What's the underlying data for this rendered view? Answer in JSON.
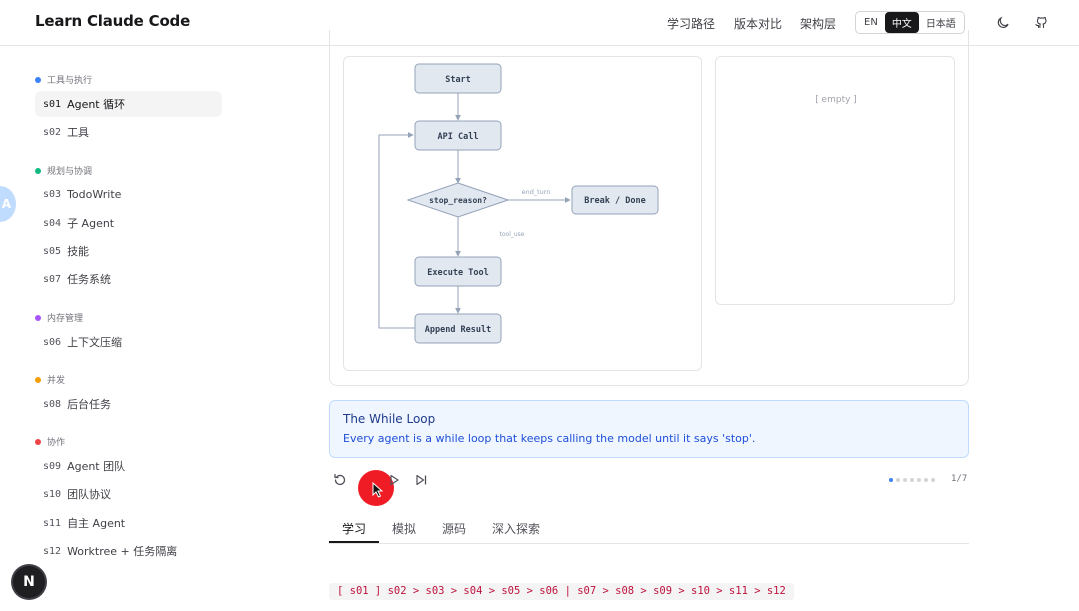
{
  "header": {
    "brand": "Learn Claude Code",
    "nav": [
      "学习路径",
      "版本对比",
      "架构层"
    ],
    "languages": [
      "EN",
      "中文",
      "日本語"
    ],
    "active_language": "中文",
    "icons": [
      "moon-icon",
      "github-icon"
    ]
  },
  "sidebar": {
    "groups": [
      {
        "title": "工具与执行",
        "color": "#3b82f6",
        "items": [
          {
            "code": "s01",
            "label": "Agent 循环",
            "active": true
          },
          {
            "code": "s02",
            "label": "工具"
          }
        ]
      },
      {
        "title": "规划与协调",
        "color": "#10b981",
        "items": [
          {
            "code": "s03",
            "label": "TodoWrite"
          },
          {
            "code": "s04",
            "label": "子 Agent"
          },
          {
            "code": "s05",
            "label": "技能"
          },
          {
            "code": "s07",
            "label": "任务系统"
          }
        ]
      },
      {
        "title": "内存管理",
        "color": "#a855f7",
        "items": [
          {
            "code": "s06",
            "label": "上下文压缩"
          }
        ]
      },
      {
        "title": "并发",
        "color": "#f59e0b",
        "items": [
          {
            "code": "s08",
            "label": "后台任务"
          }
        ]
      },
      {
        "title": "协作",
        "color": "#ef4444",
        "items": [
          {
            "code": "s09",
            "label": "Agent 团队"
          },
          {
            "code": "s10",
            "label": "团队协议"
          },
          {
            "code": "s11",
            "label": "自主 Agent"
          },
          {
            "code": "s12",
            "label": "Worktree + 任务隔离"
          }
        ]
      }
    ]
  },
  "bubble_letter": "A",
  "next_badge": "N",
  "flow": {
    "nodes": {
      "start": "Start",
      "api": "API Call",
      "decision": "stop_reason?",
      "done": "Break / Done",
      "exec": "Execute Tool",
      "append": "Append Result"
    },
    "edges": {
      "end_turn": "end_turn",
      "tool_use": "tool_use"
    }
  },
  "state_panel": {
    "empty_text": "[ empty ]"
  },
  "info": {
    "title": "The While Loop",
    "description": "Every agent is a while loop that keeps calling the model until it says 'stop'."
  },
  "controls": {
    "icons": [
      "reset-icon",
      "play-icon",
      "skip-end-icon"
    ],
    "current_step": 1,
    "total_steps": 7,
    "step_text": "1/7"
  },
  "tabs": [
    "学习",
    "模拟",
    "源码",
    "深入探索"
  ],
  "active_tab": "学习",
  "progress_path": "[ s01 ] s02 > s03 > s04 > s05 > s06 | s07 > s08 > s09 > s10 > s11 > s12"
}
